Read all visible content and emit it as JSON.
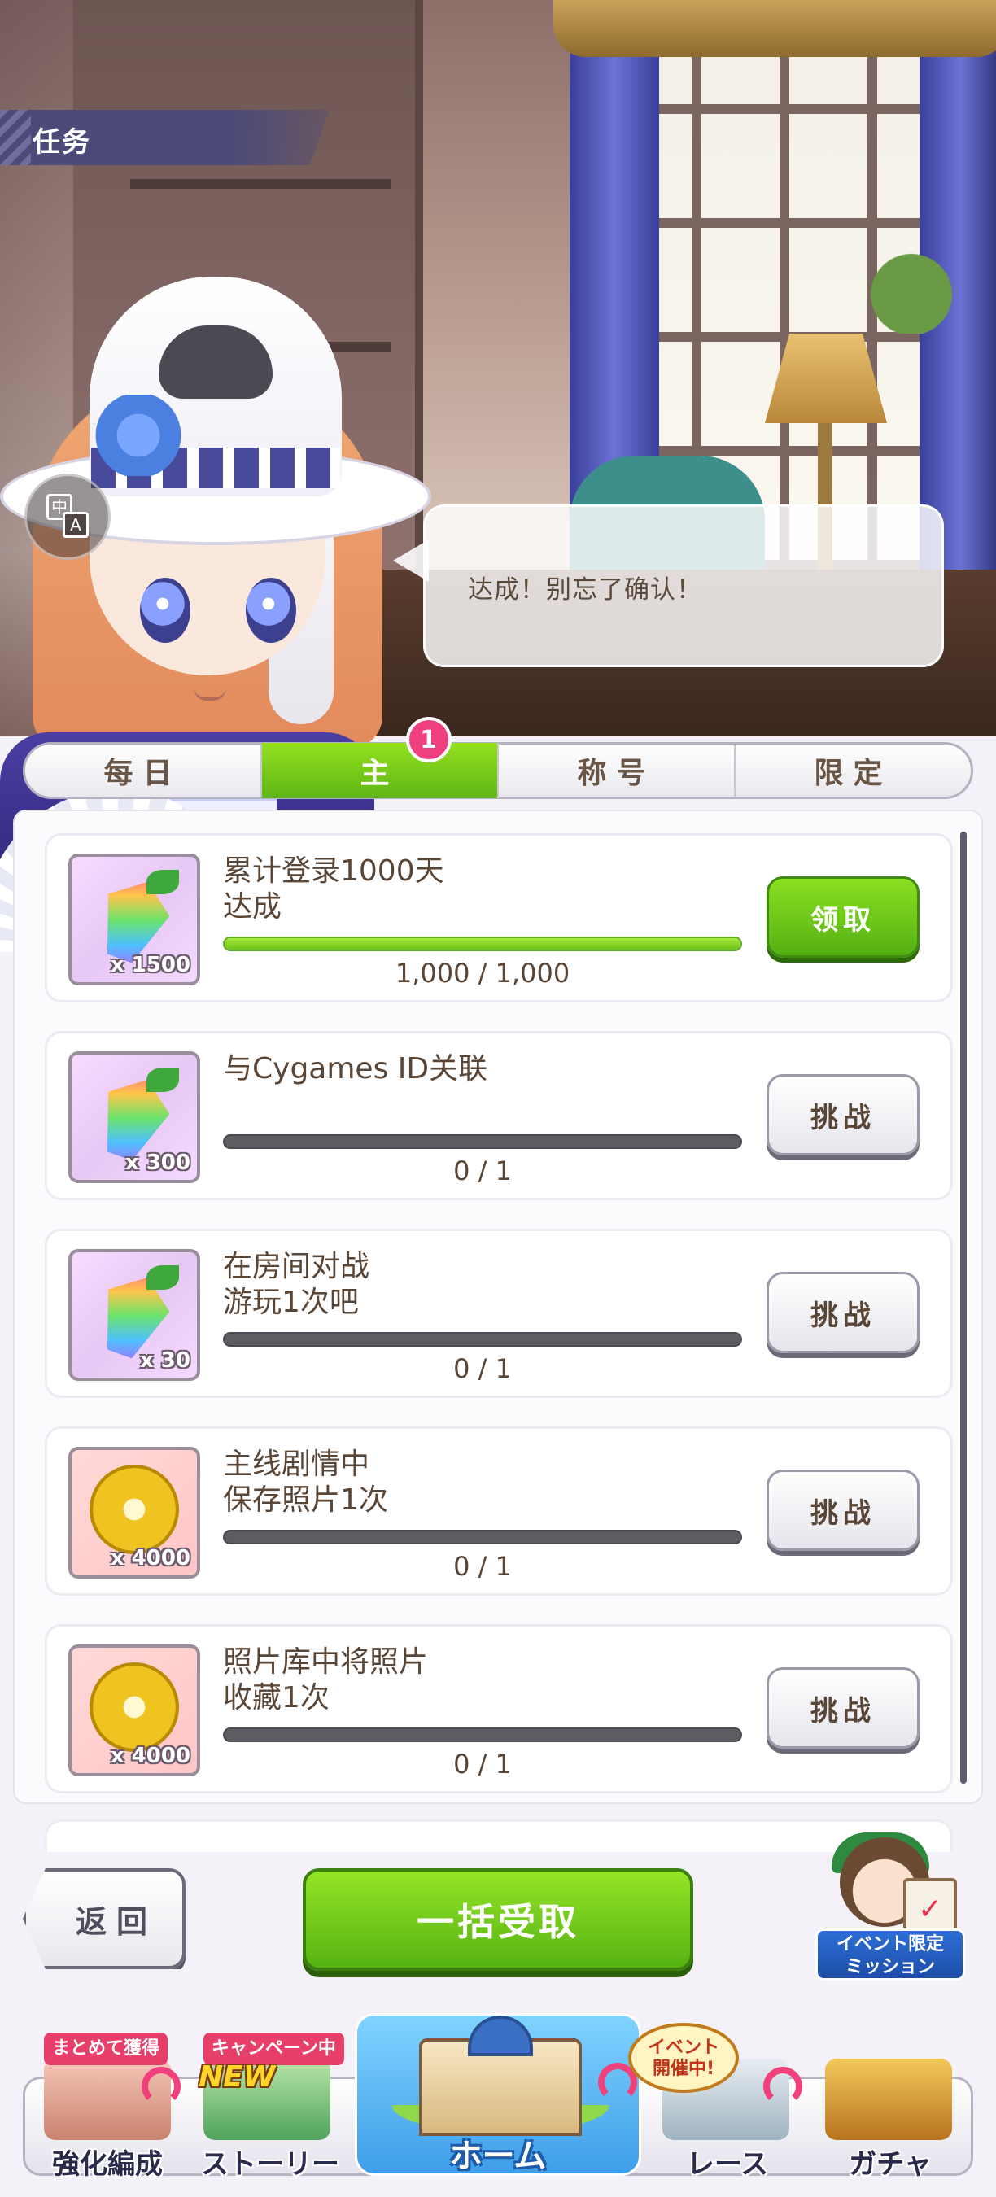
{
  "header": {
    "title": "任务",
    "translate_icon": "translate-icon",
    "translate_glyph_a": "中",
    "translate_glyph_b": "A",
    "speech": "达成！别忘了确认！"
  },
  "tabs": [
    {
      "label": "每日",
      "active": false
    },
    {
      "label": "主",
      "active": true,
      "badge": "1"
    },
    {
      "label": "称号",
      "active": false
    },
    {
      "label": "限定",
      "active": false
    }
  ],
  "missions": [
    {
      "title": "累计登录1000天\n达成",
      "reward_type": "crystal",
      "reward_qty": "x 1500",
      "progress": "1,000 / 1,000",
      "fraction": 1.0,
      "button": "领取",
      "claimable": true
    },
    {
      "title": "与Cygames ID关联",
      "reward_type": "crystal",
      "reward_qty": "x 300",
      "progress": "0 / 1",
      "fraction": 0,
      "button": "挑战",
      "claimable": false
    },
    {
      "title": "在房间对战\n游玩1次吧",
      "reward_type": "crystal",
      "reward_qty": "x 30",
      "progress": "0 / 1",
      "fraction": 0,
      "button": "挑战",
      "claimable": false
    },
    {
      "title": "主线剧情中\n保存照片1次",
      "reward_type": "coin",
      "reward_qty": "x 4000",
      "progress": "0 / 1",
      "fraction": 0,
      "button": "挑战",
      "claimable": false
    },
    {
      "title": "照片库中将照片\n收藏1次",
      "reward_type": "coin",
      "reward_qty": "x 4000",
      "progress": "0 / 1",
      "fraction": 0,
      "button": "挑战",
      "claimable": false
    }
  ],
  "controls": {
    "back": "返回",
    "claim_all": "一括受取",
    "event_mission": "イベント限定\nミッション"
  },
  "nav": {
    "enhance": {
      "label": "強化編成",
      "tag": "まとめて獲得"
    },
    "story": {
      "label": "ストーリー",
      "tag": "キャンペーン中",
      "new": "NEW"
    },
    "home": {
      "label": "ホーム"
    },
    "race": {
      "label": "レース",
      "bubble": "イベント\n開催中!"
    },
    "gacha": {
      "label": "ガチャ"
    }
  },
  "colors": {
    "accent_green": "#5fb614",
    "badge_pink": "#ef3f7e",
    "text_brown": "#5a4636"
  }
}
